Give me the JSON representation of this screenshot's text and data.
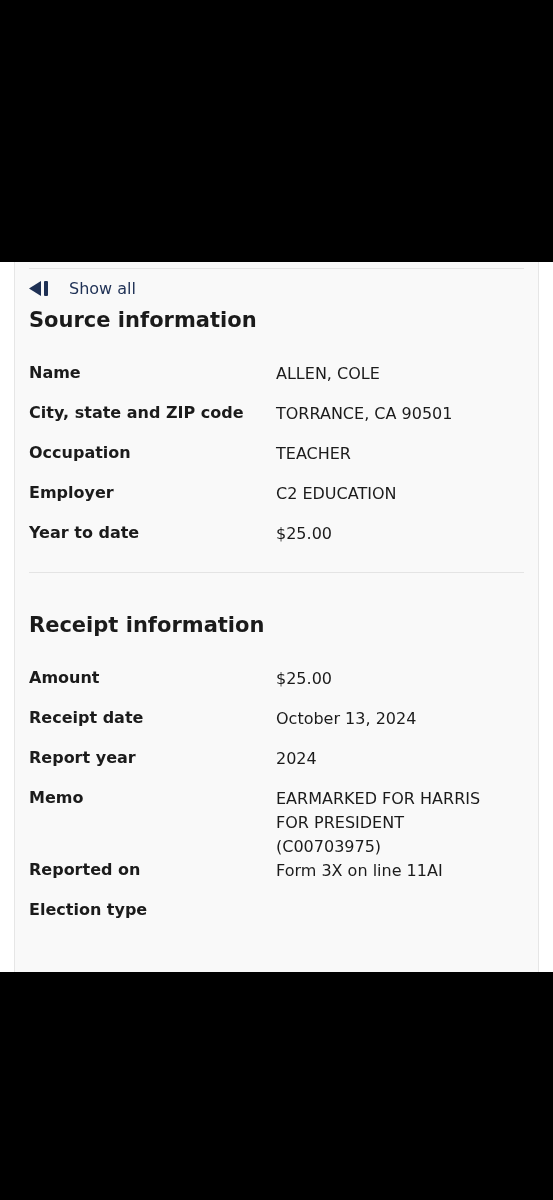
{
  "show_all_link": {
    "label": "Show all"
  },
  "sections": [
    {
      "title": "Source information",
      "rows": [
        {
          "label": "Name",
          "value": "ALLEN, COLE"
        },
        {
          "label": "City, state and ZIP code",
          "value": "TORRANCE, CA 90501"
        },
        {
          "label": "Occupation",
          "value": "TEACHER"
        },
        {
          "label": "Employer",
          "value": "C2 EDUCATION"
        },
        {
          "label": "Year to date",
          "value": "$25.00"
        }
      ]
    },
    {
      "title": "Receipt information",
      "rows": [
        {
          "label": "Amount",
          "value": "$25.00"
        },
        {
          "label": "Receipt date",
          "value": "October 13, 2024"
        },
        {
          "label": "Report year",
          "value": "2024"
        },
        {
          "label": "Memo",
          "value": "EARMARKED FOR HARRIS FOR PRESIDENT (C00703975)"
        },
        {
          "label": "Reported on",
          "value": "Form 3X on line 11AI"
        },
        {
          "label": "Election type"
        }
      ]
    }
  ]
}
